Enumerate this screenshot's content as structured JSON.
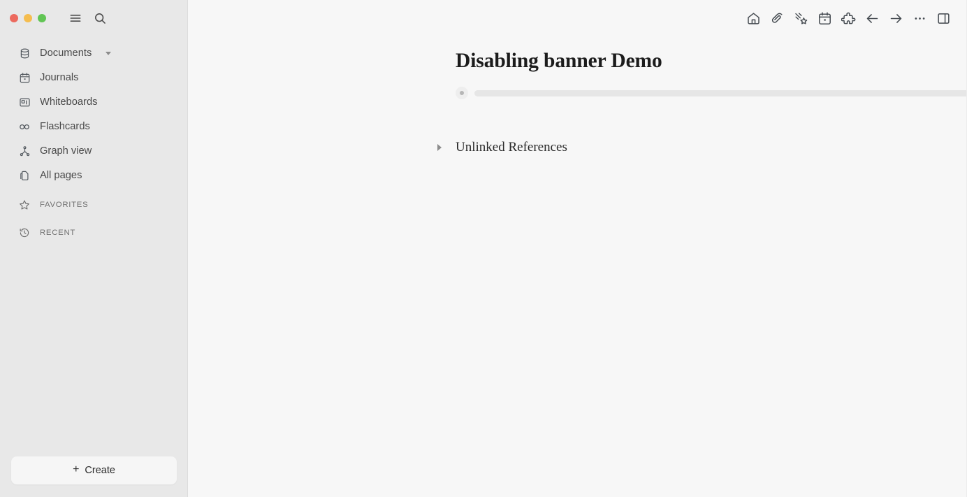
{
  "window": {
    "traffic_lights": [
      {
        "name": "close",
        "color": "#ec6a5e"
      },
      {
        "name": "minimize",
        "color": "#f5bd4f"
      },
      {
        "name": "maximize",
        "color": "#61c554"
      }
    ]
  },
  "sidebar": {
    "top_actions": [
      {
        "id": "menu",
        "icon": "hamburger-icon",
        "label": "Menu"
      },
      {
        "id": "search",
        "icon": "search-icon",
        "label": "Search"
      }
    ],
    "items": [
      {
        "id": "documents",
        "label": "Documents",
        "icon": "database-icon",
        "has_caret": true
      },
      {
        "id": "journals",
        "label": "Journals",
        "icon": "calendar-icon",
        "has_caret": false
      },
      {
        "id": "whiteboards",
        "label": "Whiteboards",
        "icon": "whiteboard-icon",
        "has_caret": false
      },
      {
        "id": "flashcards",
        "label": "Flashcards",
        "icon": "infinity-icon",
        "has_caret": false
      },
      {
        "id": "graph-view",
        "label": "Graph view",
        "icon": "graph-icon",
        "has_caret": false
      },
      {
        "id": "all-pages",
        "label": "All pages",
        "icon": "pages-icon",
        "has_caret": false
      }
    ],
    "sections": [
      {
        "id": "favorites",
        "label": "FAVORITES",
        "icon": "star-icon"
      },
      {
        "id": "recent",
        "label": "RECENT",
        "icon": "history-icon"
      }
    ],
    "create_button": {
      "label": "Create",
      "plus": "+"
    }
  },
  "toolbar": {
    "buttons": [
      {
        "id": "home",
        "icon": "home-icon",
        "label": "Home"
      },
      {
        "id": "capture",
        "icon": "paperclip-icon",
        "label": "Capture"
      },
      {
        "id": "flashcards",
        "icon": "shooting-star-icon",
        "label": "Flashcards"
      },
      {
        "id": "journals",
        "icon": "calendar-icon",
        "label": "Journals"
      },
      {
        "id": "plugins",
        "icon": "puzzle-icon",
        "label": "Plugins"
      },
      {
        "id": "back",
        "icon": "arrow-left-icon",
        "label": "Go back"
      },
      {
        "id": "forward",
        "icon": "arrow-right-icon",
        "label": "Go forward"
      },
      {
        "id": "more",
        "icon": "ellipsis-icon",
        "label": "More"
      },
      {
        "id": "right-sidebar",
        "icon": "sidebar-right-icon",
        "label": "Toggle right sidebar"
      }
    ]
  },
  "page": {
    "title": "Disabling banner Demo",
    "block": {
      "placeholder": ""
    },
    "unlinked_references": {
      "label": "Unlinked References",
      "expanded": false
    }
  },
  "colors": {
    "sidebar_bg": "#e8e8e8",
    "main_bg": "#f7f7f7",
    "text": "#2a2a2a",
    "muted": "#707070",
    "placeholder_bar": "#e6e6e6"
  }
}
